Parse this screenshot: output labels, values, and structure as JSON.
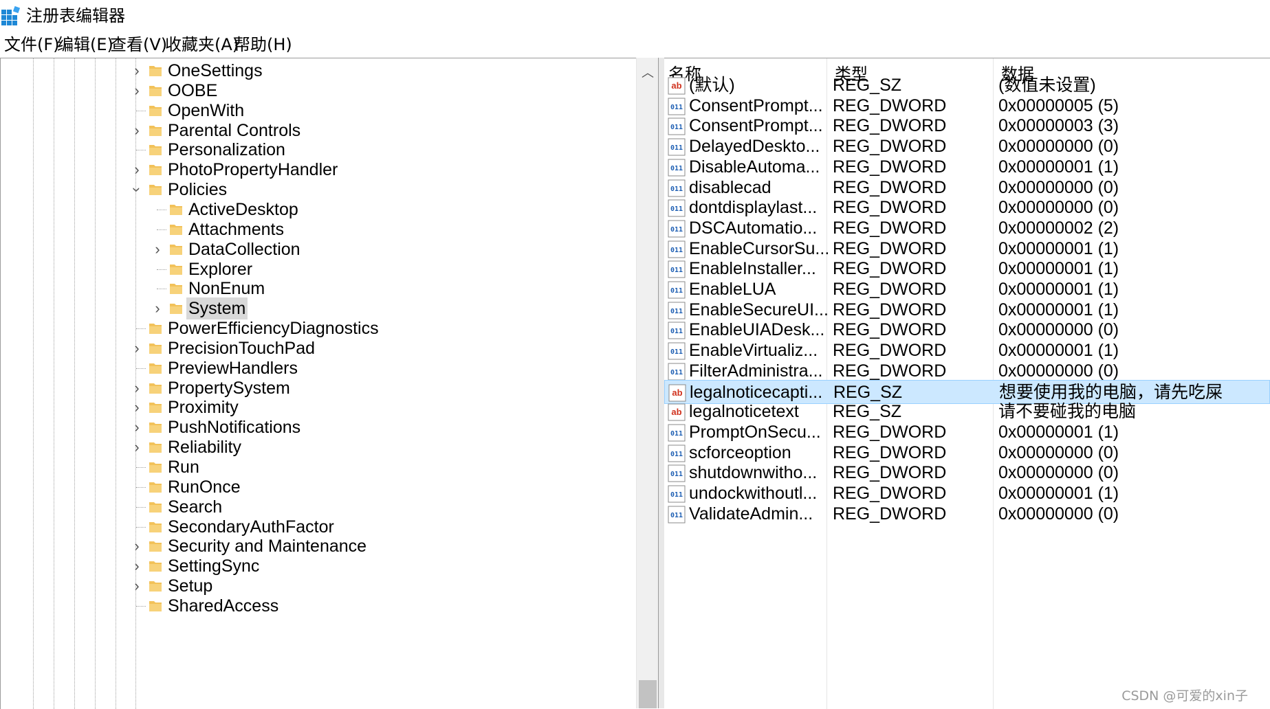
{
  "window": {
    "title": "注册表编辑器"
  },
  "menu": {
    "items": [
      "文件(F)",
      "编辑(E)",
      "查看(V)",
      "收藏夹(A)",
      "帮助(H)"
    ]
  },
  "tree": {
    "items": [
      {
        "label": "OneSettings",
        "expander": "collapsed",
        "level": 1
      },
      {
        "label": "OOBE",
        "expander": "collapsed",
        "level": 1
      },
      {
        "label": "OpenWith",
        "expander": "none",
        "level": 1
      },
      {
        "label": "Parental Controls",
        "expander": "collapsed",
        "level": 1
      },
      {
        "label": "Personalization",
        "expander": "none",
        "level": 1
      },
      {
        "label": "PhotoPropertyHandler",
        "expander": "collapsed",
        "level": 1
      },
      {
        "label": "Policies",
        "expander": "expanded",
        "level": 1
      },
      {
        "label": "ActiveDesktop",
        "expander": "none",
        "level": 2
      },
      {
        "label": "Attachments",
        "expander": "none",
        "level": 2
      },
      {
        "label": "DataCollection",
        "expander": "collapsed",
        "level": 2
      },
      {
        "label": "Explorer",
        "expander": "none",
        "level": 2
      },
      {
        "label": "NonEnum",
        "expander": "none",
        "level": 2
      },
      {
        "label": "System",
        "expander": "collapsed",
        "level": 2,
        "selected": true
      },
      {
        "label": "PowerEfficiencyDiagnostics",
        "expander": "none",
        "level": 1
      },
      {
        "label": "PrecisionTouchPad",
        "expander": "collapsed",
        "level": 1
      },
      {
        "label": "PreviewHandlers",
        "expander": "none",
        "level": 1
      },
      {
        "label": "PropertySystem",
        "expander": "collapsed",
        "level": 1
      },
      {
        "label": "Proximity",
        "expander": "collapsed",
        "level": 1
      },
      {
        "label": "PushNotifications",
        "expander": "collapsed",
        "level": 1
      },
      {
        "label": "Reliability",
        "expander": "collapsed",
        "level": 1
      },
      {
        "label": "Run",
        "expander": "none",
        "level": 1
      },
      {
        "label": "RunOnce",
        "expander": "none",
        "level": 1
      },
      {
        "label": "Search",
        "expander": "none",
        "level": 1
      },
      {
        "label": "SecondaryAuthFactor",
        "expander": "none",
        "level": 1
      },
      {
        "label": "Security and Maintenance",
        "expander": "collapsed",
        "level": 1
      },
      {
        "label": "SettingSync",
        "expander": "collapsed",
        "level": 1
      },
      {
        "label": "Setup",
        "expander": "collapsed",
        "level": 1
      },
      {
        "label": "SharedAccess",
        "expander": "none",
        "level": 1
      }
    ]
  },
  "list": {
    "columns": {
      "name": "名称",
      "type": "类型",
      "data": "数据"
    },
    "rows": [
      {
        "icon": "string-value-icon",
        "name": "(默认)",
        "type": "REG_SZ",
        "data": "(数值未设置)"
      },
      {
        "icon": "dword-value-icon",
        "name": "ConsentPrompt...",
        "type": "REG_DWORD",
        "data": "0x00000005 (5)"
      },
      {
        "icon": "dword-value-icon",
        "name": "ConsentPrompt...",
        "type": "REG_DWORD",
        "data": "0x00000003 (3)"
      },
      {
        "icon": "dword-value-icon",
        "name": "DelayedDeskto...",
        "type": "REG_DWORD",
        "data": "0x00000000 (0)"
      },
      {
        "icon": "dword-value-icon",
        "name": "DisableAutoma...",
        "type": "REG_DWORD",
        "data": "0x00000001 (1)"
      },
      {
        "icon": "dword-value-icon",
        "name": "disablecad",
        "type": "REG_DWORD",
        "data": "0x00000000 (0)"
      },
      {
        "icon": "dword-value-icon",
        "name": "dontdisplaylast...",
        "type": "REG_DWORD",
        "data": "0x00000000 (0)"
      },
      {
        "icon": "dword-value-icon",
        "name": "DSCAutomatio...",
        "type": "REG_DWORD",
        "data": "0x00000002 (2)"
      },
      {
        "icon": "dword-value-icon",
        "name": "EnableCursorSu...",
        "type": "REG_DWORD",
        "data": "0x00000001 (1)"
      },
      {
        "icon": "dword-value-icon",
        "name": "EnableInstaller...",
        "type": "REG_DWORD",
        "data": "0x00000001 (1)"
      },
      {
        "icon": "dword-value-icon",
        "name": "EnableLUA",
        "type": "REG_DWORD",
        "data": "0x00000001 (1)"
      },
      {
        "icon": "dword-value-icon",
        "name": "EnableSecureUI...",
        "type": "REG_DWORD",
        "data": "0x00000001 (1)"
      },
      {
        "icon": "dword-value-icon",
        "name": "EnableUIADesk...",
        "type": "REG_DWORD",
        "data": "0x00000000 (0)"
      },
      {
        "icon": "dword-value-icon",
        "name": "EnableVirtualiz...",
        "type": "REG_DWORD",
        "data": "0x00000001 (1)"
      },
      {
        "icon": "dword-value-icon",
        "name": "FilterAdministra...",
        "type": "REG_DWORD",
        "data": "0x00000000 (0)"
      },
      {
        "icon": "string-value-icon",
        "name": "legalnoticecapti...",
        "type": "REG_SZ",
        "data": "想要使用我的电脑，请先吃屎",
        "selected": true
      },
      {
        "icon": "string-value-icon",
        "name": "legalnoticetext",
        "type": "REG_SZ",
        "data": "请不要碰我的电脑"
      },
      {
        "icon": "dword-value-icon",
        "name": "PromptOnSecu...",
        "type": "REG_DWORD",
        "data": "0x00000001 (1)"
      },
      {
        "icon": "dword-value-icon",
        "name": "scforceoption",
        "type": "REG_DWORD",
        "data": "0x00000000 (0)"
      },
      {
        "icon": "dword-value-icon",
        "name": "shutdownwitho...",
        "type": "REG_DWORD",
        "data": "0x00000000 (0)"
      },
      {
        "icon": "dword-value-icon",
        "name": "undockwithoutl...",
        "type": "REG_DWORD",
        "data": "0x00000001 (1)"
      },
      {
        "icon": "dword-value-icon",
        "name": "ValidateAdmin...",
        "type": "REG_DWORD",
        "data": "0x00000000 (0)"
      }
    ]
  },
  "watermark": "CSDN @可爱的xin子",
  "colors": {
    "selection": "#cce8ff",
    "selection_border": "#99d1ff",
    "tree_selected": "#d9d9d9",
    "folder": "#f2c25a"
  }
}
